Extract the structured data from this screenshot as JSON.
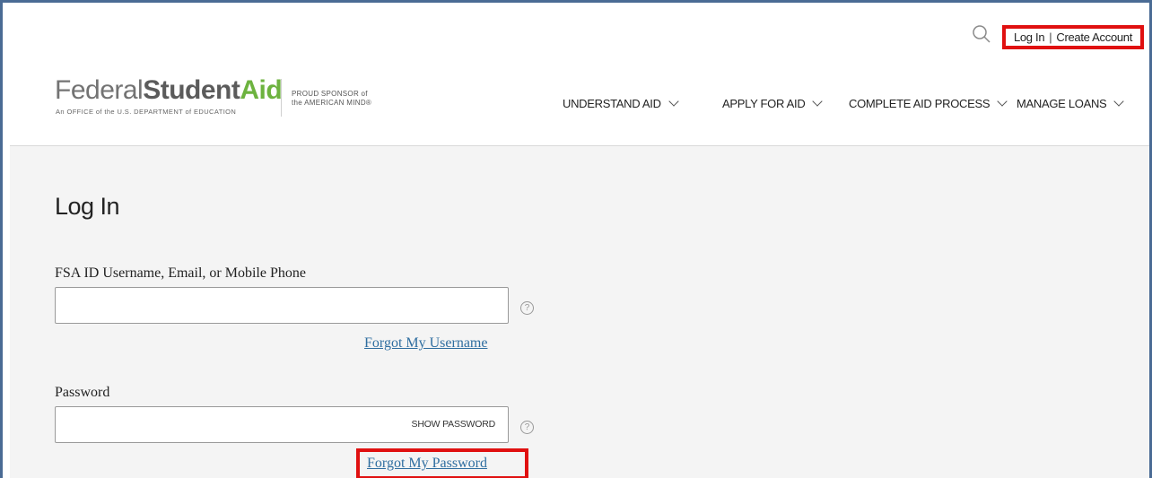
{
  "header": {
    "utility": {
      "login": "Log In",
      "separator": "|",
      "create_account": "Create Account"
    },
    "logo": {
      "part1": "Federal",
      "part2": "Student",
      "part3": "Aid",
      "subline": "An OFFICE of the U.S. DEPARTMENT of EDUCATION",
      "sponsor_line1": "PROUD SPONSOR of",
      "sponsor_line2": "the AMERICAN MIND®"
    },
    "nav": [
      {
        "label": "UNDERSTAND AID"
      },
      {
        "label": "APPLY FOR AID"
      },
      {
        "label": "COMPLETE AID PROCESS"
      },
      {
        "label": "MANAGE LOANS"
      }
    ]
  },
  "login_form": {
    "title": "Log In",
    "username_label": "FSA ID Username, Email, or Mobile Phone",
    "username_value": "",
    "forgot_username": "Forgot My Username",
    "password_label": "Password",
    "password_value": "",
    "show_password": "SHOW PASSWORD",
    "forgot_password": "Forgot My Password",
    "help_glyph": "?"
  },
  "colors": {
    "accent_green": "#6db33f",
    "link_blue": "#2f6ea0",
    "highlight_red": "#e01010",
    "frame_blue": "#4a6b94"
  }
}
